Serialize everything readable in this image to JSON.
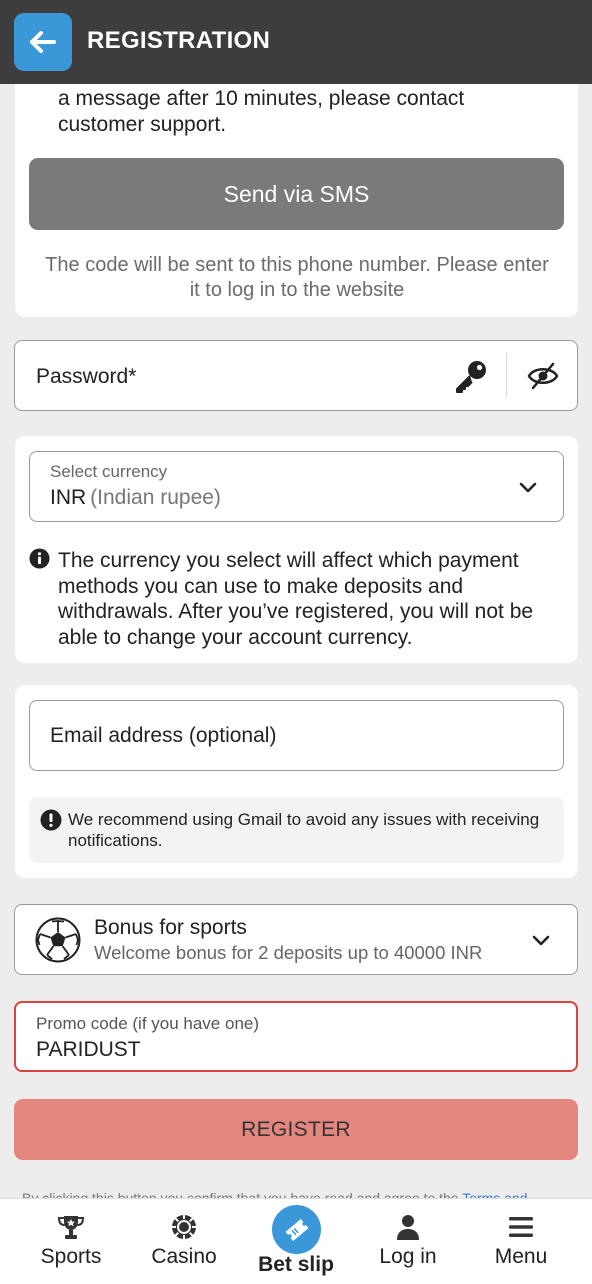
{
  "header": {
    "title": "REGISTRATION",
    "back_icon": "arrow-left-icon"
  },
  "sms_section": {
    "message_tail": "a message after 10 minutes, please contact customer support.",
    "send_button": "Send via SMS",
    "note": "The code will be sent to this phone number. Please enter it to log in to the website"
  },
  "password": {
    "label": "Password*",
    "key_icon": "key-icon",
    "visibility_icon": "eye-slash-icon"
  },
  "currency": {
    "label": "Select currency",
    "value": "INR",
    "value_detail": "(Indian rupee)",
    "note": "The currency you select will affect which payment methods you can use to make deposits and withdrawals. After you’ve registered, you will not be able to change your account currency."
  },
  "email": {
    "label": "Email address (optional)",
    "note": "We recommend using Gmail to avoid any issues with receiving notifications."
  },
  "bonus": {
    "title": "Bonus for sports",
    "subtitle": "Welcome bonus for 2 deposits up to 40000 INR",
    "icon": "soccer-ball-icon"
  },
  "promo": {
    "label": "Promo code (if you have one)",
    "value": "PARIDUST"
  },
  "register_button": "REGISTER",
  "terms": {
    "text": "By clicking this button you confirm that you have read and agree to the ",
    "link": "Terms and"
  },
  "tabbar": {
    "items": [
      {
        "label": "Sports",
        "icon": "trophy-icon"
      },
      {
        "label": "Casino",
        "icon": "casino-chip-icon"
      },
      {
        "label": "Bet slip",
        "icon": "ticket-icon"
      },
      {
        "label": "Log in",
        "icon": "user-icon"
      },
      {
        "label": "Menu",
        "icon": "hamburger-icon"
      }
    ]
  },
  "colors": {
    "header_bg": "#3d3d3d",
    "accent_blue": "#3a97d8",
    "register_bg": "#e3867e",
    "promo_border": "#d9443f"
  }
}
